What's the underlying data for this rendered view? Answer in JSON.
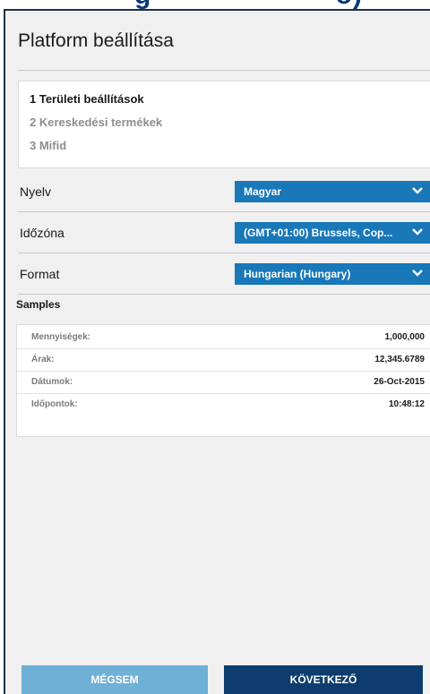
{
  "dialog": {
    "title": "Platform beállítása"
  },
  "steps": [
    {
      "label": "1 Területi beállítások"
    },
    {
      "label": "2 Kereskedési termékek"
    },
    {
      "label": "3 Mifid"
    }
  ],
  "settings": [
    {
      "label": "Nyelv",
      "value": "Magyar"
    },
    {
      "label": "Időzóna",
      "value": "(GMT+01:00) Brussels, Cop..."
    },
    {
      "label": "Format",
      "value": "Hungarian (Hungary)"
    }
  ],
  "samples": {
    "title": "Samples",
    "rows": [
      {
        "key": "Mennyiségek:",
        "value": "1,000,000"
      },
      {
        "key": "Árak:",
        "value": "12,345.6789"
      },
      {
        "key": "Dátumok:",
        "value": "26-Oct-2015"
      },
      {
        "key": "Időpontok:",
        "value": "10:48:12"
      }
    ]
  },
  "buttons": {
    "cancel": "MÉGSEM",
    "next": "KÖVETKEZŐ"
  },
  "icons": {
    "dropdown": "chevron-down-icon"
  },
  "colors": {
    "select_bg": "#1878b8",
    "cancel_bg": "#6fb0d6",
    "next_bg": "#0c3d6e"
  }
}
